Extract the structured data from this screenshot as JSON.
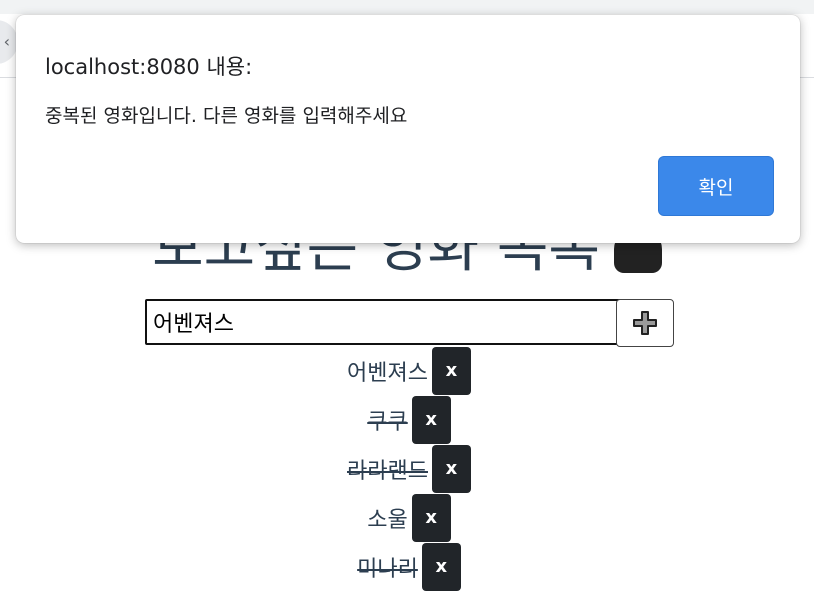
{
  "browser": {
    "back_glyph": "‹"
  },
  "page": {
    "title": "보고싶은 영화 목록",
    "emoji_icon": "popcorn-icon"
  },
  "input": {
    "value": "어벤져스",
    "add_icon": "plus-icon"
  },
  "movies": [
    {
      "name": "어벤져스",
      "done": false,
      "delete_label": "x"
    },
    {
      "name": "쿠쿠",
      "done": true,
      "delete_label": "x"
    },
    {
      "name": "라라랜드",
      "done": true,
      "delete_label": "x"
    },
    {
      "name": "소울",
      "done": false,
      "delete_label": "x"
    },
    {
      "name": "미나리",
      "done": true,
      "delete_label": "x"
    }
  ],
  "dialog": {
    "title": "localhost:8080 내용:",
    "message": "중복된 영화입니다. 다른 영화를 입력해주세요",
    "confirm_label": "확인"
  },
  "colors": {
    "text": "#2c3e50",
    "delete_button": "#212529",
    "confirm_button": "#3b88ea"
  }
}
